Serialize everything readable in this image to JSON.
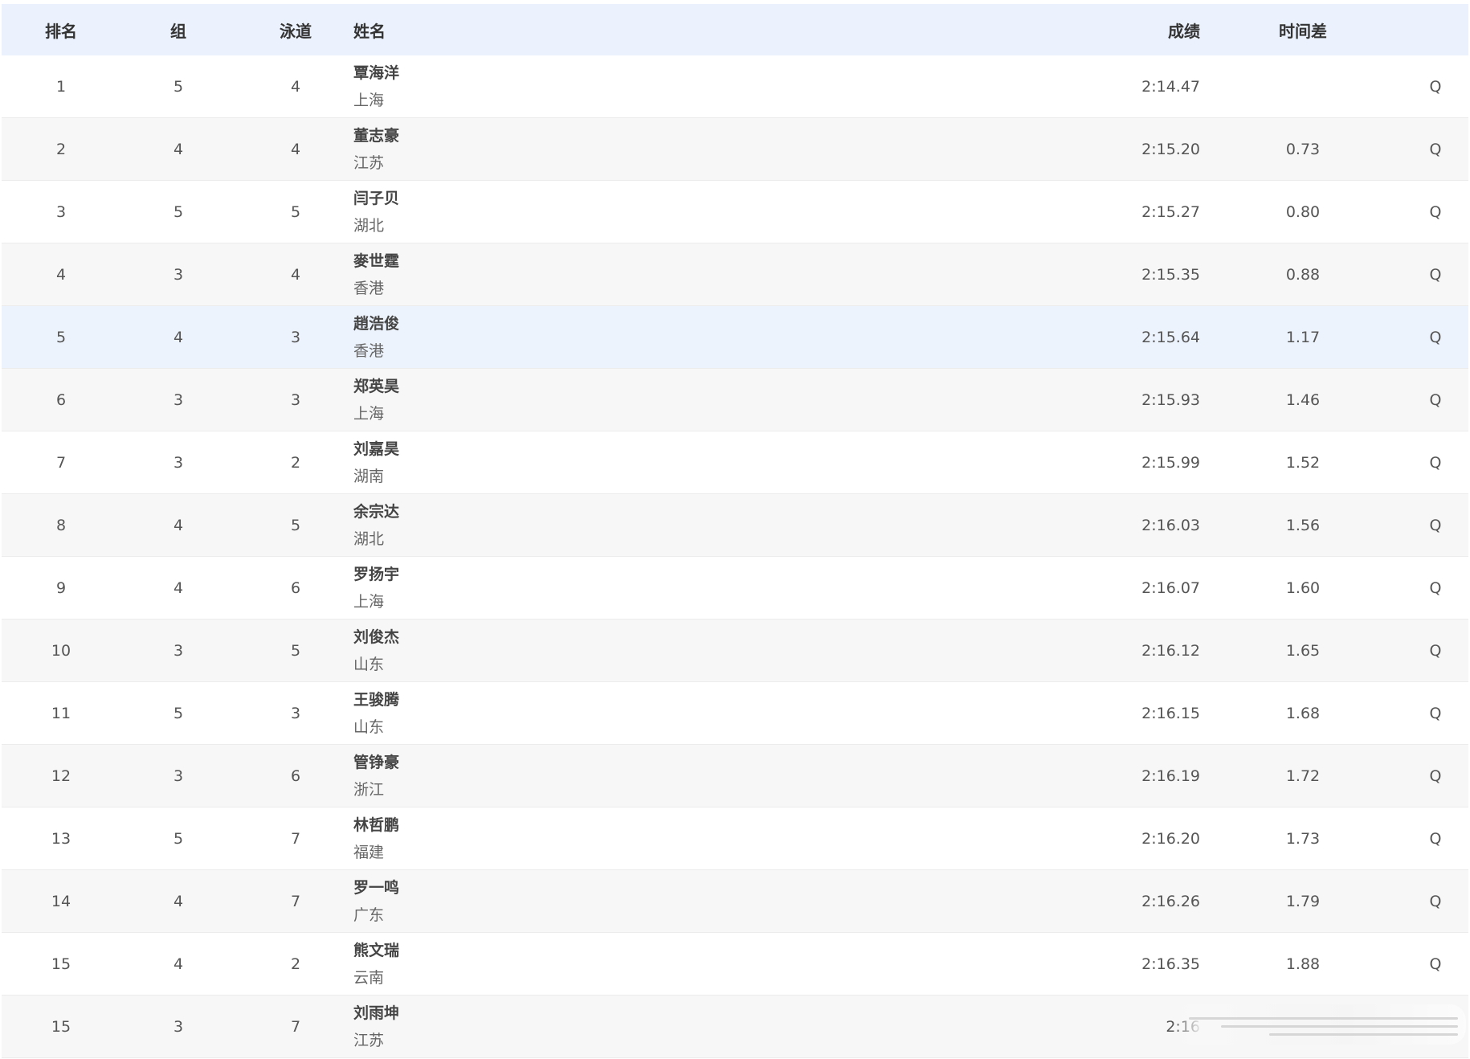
{
  "header": {
    "rank": "排名",
    "heat": "组",
    "lane": "泳道",
    "name": "姓名",
    "time": "成绩",
    "gap": "时间差"
  },
  "rows": [
    {
      "rank": "1",
      "heat": "5",
      "lane": "4",
      "name": "覃海洋",
      "team": "上海",
      "time": "2:14.47",
      "gap": "",
      "q": "Q"
    },
    {
      "rank": "2",
      "heat": "4",
      "lane": "4",
      "name": "董志豪",
      "team": "江苏",
      "time": "2:15.20",
      "gap": "0.73",
      "q": "Q"
    },
    {
      "rank": "3",
      "heat": "5",
      "lane": "5",
      "name": "闫子贝",
      "team": "湖北",
      "time": "2:15.27",
      "gap": "0.80",
      "q": "Q"
    },
    {
      "rank": "4",
      "heat": "3",
      "lane": "4",
      "name": "麥世霆",
      "team": "香港",
      "time": "2:15.35",
      "gap": "0.88",
      "q": "Q"
    },
    {
      "rank": "5",
      "heat": "4",
      "lane": "3",
      "name": "趙浩俊",
      "team": "香港",
      "time": "2:15.64",
      "gap": "1.17",
      "q": "Q"
    },
    {
      "rank": "6",
      "heat": "3",
      "lane": "3",
      "name": "郑英昊",
      "team": "上海",
      "time": "2:15.93",
      "gap": "1.46",
      "q": "Q"
    },
    {
      "rank": "7",
      "heat": "3",
      "lane": "2",
      "name": "刘嘉昊",
      "team": "湖南",
      "time": "2:15.99",
      "gap": "1.52",
      "q": "Q"
    },
    {
      "rank": "8",
      "heat": "4",
      "lane": "5",
      "name": "余宗达",
      "team": "湖北",
      "time": "2:16.03",
      "gap": "1.56",
      "q": "Q"
    },
    {
      "rank": "9",
      "heat": "4",
      "lane": "6",
      "name": "罗扬宇",
      "team": "上海",
      "time": "2:16.07",
      "gap": "1.60",
      "q": "Q"
    },
    {
      "rank": "10",
      "heat": "3",
      "lane": "5",
      "name": "刘俊杰",
      "team": "山东",
      "time": "2:16.12",
      "gap": "1.65",
      "q": "Q"
    },
    {
      "rank": "11",
      "heat": "5",
      "lane": "3",
      "name": "王骏腾",
      "team": "山东",
      "time": "2:16.15",
      "gap": "1.68",
      "q": "Q"
    },
    {
      "rank": "12",
      "heat": "3",
      "lane": "6",
      "name": "管铮豪",
      "team": "浙江",
      "time": "2:16.19",
      "gap": "1.72",
      "q": "Q"
    },
    {
      "rank": "13",
      "heat": "5",
      "lane": "7",
      "name": "林哲鹏",
      "team": "福建",
      "time": "2:16.20",
      "gap": "1.73",
      "q": "Q"
    },
    {
      "rank": "14",
      "heat": "4",
      "lane": "7",
      "name": "罗一鸣",
      "team": "广东",
      "time": "2:16.26",
      "gap": "1.79",
      "q": "Q"
    },
    {
      "rank": "15",
      "heat": "4",
      "lane": "2",
      "name": "熊文瑞",
      "team": "云南",
      "time": "2:16.35",
      "gap": "1.88",
      "q": "Q"
    },
    {
      "rank": "15",
      "heat": "3",
      "lane": "7",
      "name": "刘雨坤",
      "team": "江苏",
      "time": "2:16",
      "gap": "",
      "q": ""
    }
  ],
  "styles": {
    "header_bg": "#ebf2fd",
    "row_alt_bg": "#f7f7f7",
    "row_highlight_bg": "#edf3fc",
    "highlighted_rank": "5"
  }
}
